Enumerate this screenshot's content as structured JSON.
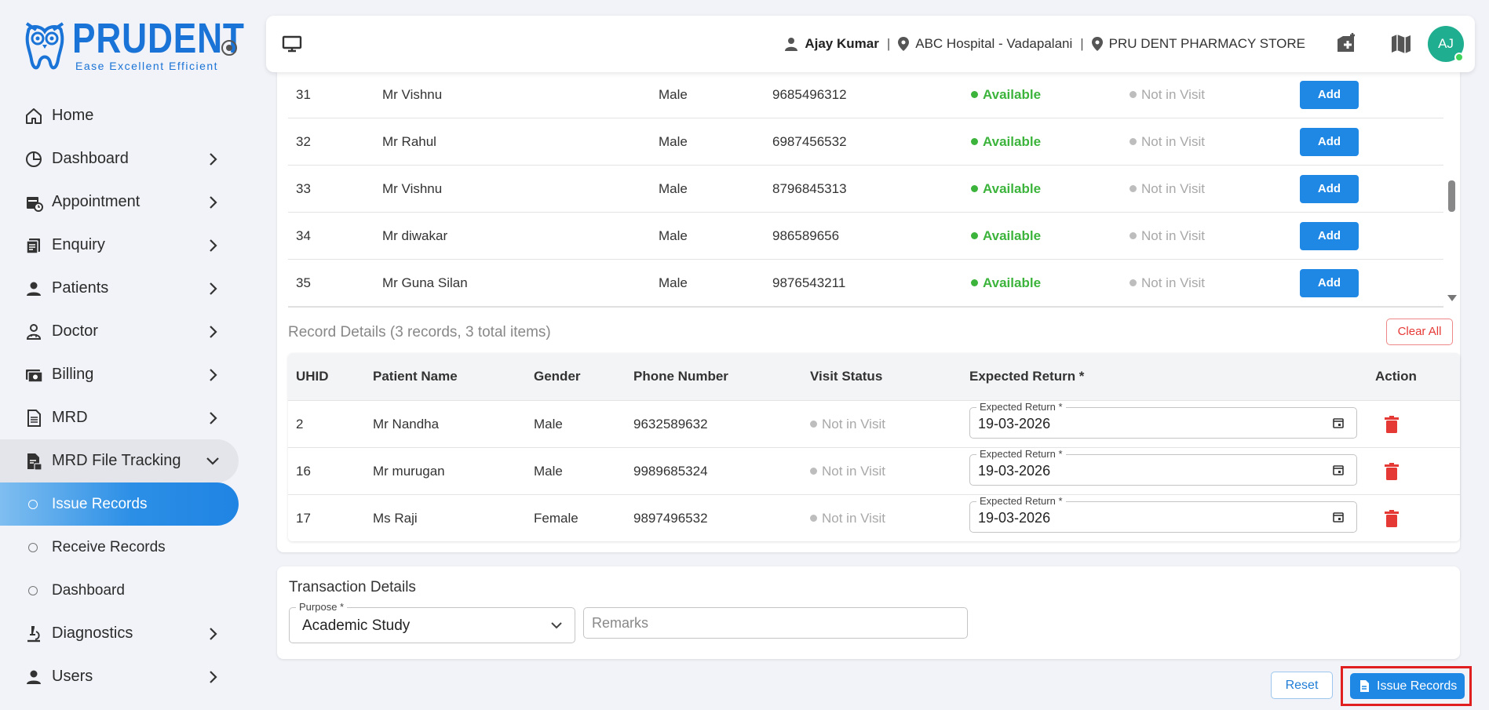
{
  "brand": {
    "name": "PRUDENT",
    "tagline": "Ease  Excellent  Efficient"
  },
  "header": {
    "user": "Ajay Kumar",
    "hospital": "ABC Hospital - Vadapalani",
    "store": "PRU DENT PHARMACY STORE",
    "avatar_initials": "AJ",
    "separator": "|"
  },
  "sidebar": {
    "items": [
      {
        "label": "Home",
        "icon": "home-icon"
      },
      {
        "label": "Dashboard",
        "icon": "pie-chart-icon"
      },
      {
        "label": "Appointment",
        "icon": "calendar-clock-icon"
      },
      {
        "label": "Enquiry",
        "icon": "document-icon"
      },
      {
        "label": "Patients",
        "icon": "person-icon"
      },
      {
        "label": "Doctor",
        "icon": "doctor-icon"
      },
      {
        "label": "Billing",
        "icon": "cash-icon"
      },
      {
        "label": "MRD",
        "icon": "file-list-icon"
      },
      {
        "label": "MRD File Tracking",
        "icon": "file-tracking-icon"
      }
    ],
    "sub_items": [
      {
        "label": "Issue Records"
      },
      {
        "label": "Receive Records"
      },
      {
        "label": "Dashboard"
      }
    ],
    "bottom_items": [
      {
        "label": "Diagnostics",
        "icon": "microscope-icon"
      },
      {
        "label": "Users",
        "icon": "person-icon"
      }
    ]
  },
  "patients": {
    "rows": [
      {
        "id": "31",
        "name": "Mr Vishnu",
        "gender": "Male",
        "phone": "9685496312",
        "availability": "Available",
        "visit": "Not in Visit",
        "action": "Add"
      },
      {
        "id": "32",
        "name": "Mr Rahul",
        "gender": "Male",
        "phone": "6987456532",
        "availability": "Available",
        "visit": "Not in Visit",
        "action": "Add"
      },
      {
        "id": "33",
        "name": "Mr Vishnu",
        "gender": "Male",
        "phone": "8796845313",
        "availability": "Available",
        "visit": "Not in Visit",
        "action": "Add"
      },
      {
        "id": "34",
        "name": "Mr diwakar",
        "gender": "Male",
        "phone": "986589656",
        "availability": "Available",
        "visit": "Not in Visit",
        "action": "Add"
      },
      {
        "id": "35",
        "name": "Mr Guna Silan",
        "gender": "Male",
        "phone": "9876543211",
        "availability": "Available",
        "visit": "Not in Visit",
        "action": "Add"
      }
    ]
  },
  "record_details": {
    "title": "Record Details (3 records, 3 total items)",
    "clear_all": "Clear All",
    "headers": [
      "UHID",
      "Patient Name",
      "Gender",
      "Phone Number",
      "Visit Status",
      "Expected Return *",
      "Action"
    ],
    "date_label": "Expected Return *",
    "rows": [
      {
        "uhid": "2",
        "name": "Mr Nandha",
        "gender": "Male",
        "phone": "9632589632",
        "visit": "Not in Visit",
        "expected_return": "19-03-2026"
      },
      {
        "uhid": "16",
        "name": "Mr murugan",
        "gender": "Male",
        "phone": "9989685324",
        "visit": "Not in Visit",
        "expected_return": "19-03-2026"
      },
      {
        "uhid": "17",
        "name": "Ms Raji",
        "gender": "Female",
        "phone": "9897496532",
        "visit": "Not in Visit",
        "expected_return": "19-03-2026"
      }
    ]
  },
  "transaction": {
    "title": "Transaction Details",
    "purpose_label": "Purpose *",
    "purpose_value": "Academic Study",
    "remarks_placeholder": "Remarks"
  },
  "actions": {
    "reset": "Reset",
    "issue": "Issue Records"
  },
  "colors": {
    "primary": "#1f88e5",
    "available": "#3cb43c",
    "danger": "#e53935",
    "avatar": "#1fae8f"
  }
}
